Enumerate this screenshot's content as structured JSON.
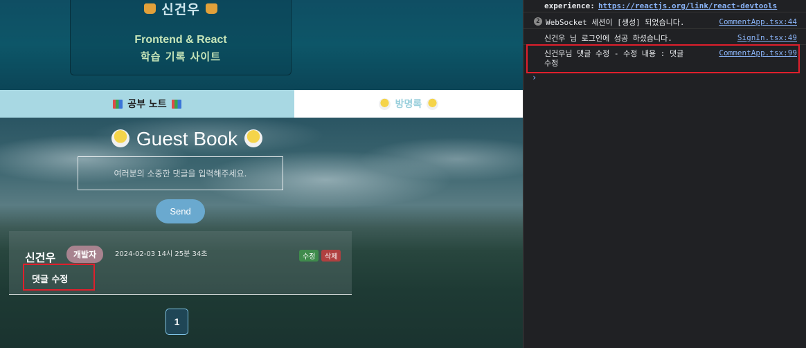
{
  "hero": {
    "name": "신건우",
    "line1": "Frontend & React",
    "line2": "학습 기록 사이트"
  },
  "tabs": [
    {
      "label": "공부 노트"
    },
    {
      "label": "방명록"
    }
  ],
  "guestbook": {
    "title": "Guest Book",
    "placeholder": "여러분의 소중한 댓글을 입력해주세요.",
    "send_label": "Send"
  },
  "comment": {
    "author": "신건우",
    "role": "개발자",
    "timestamp": "2024-02-03 14시 25분 34초",
    "edit_label": "수정",
    "delete_label": "삭제",
    "body": "댓글 수정"
  },
  "pagination": {
    "current": "1"
  },
  "console": {
    "top_label": "experience:",
    "top_link": "https://reactjs.org/link/react-devtools",
    "messages": [
      {
        "count": "2",
        "text": "WebSocket 세션이 [생성] 되었습니다.",
        "source": "CommentApp.tsx:44"
      },
      {
        "text": "신건우 님 로그인에 성공 하셨습니다.",
        "source": "SignIn.tsx:49"
      },
      {
        "text_line1": "신건우님 댓글 수정  - 수정 내용 : 댓글",
        "text_line2": "수정",
        "source": "CommentApp.tsx:99"
      }
    ],
    "prompt": "›"
  },
  "colors": {
    "highlight": "#e01f2c",
    "tab_active_bg": "#ffffff",
    "tab_inactive_bg": "#a8d8e3",
    "send_button": "#6aa9cf",
    "link": "#8ab4f8"
  }
}
